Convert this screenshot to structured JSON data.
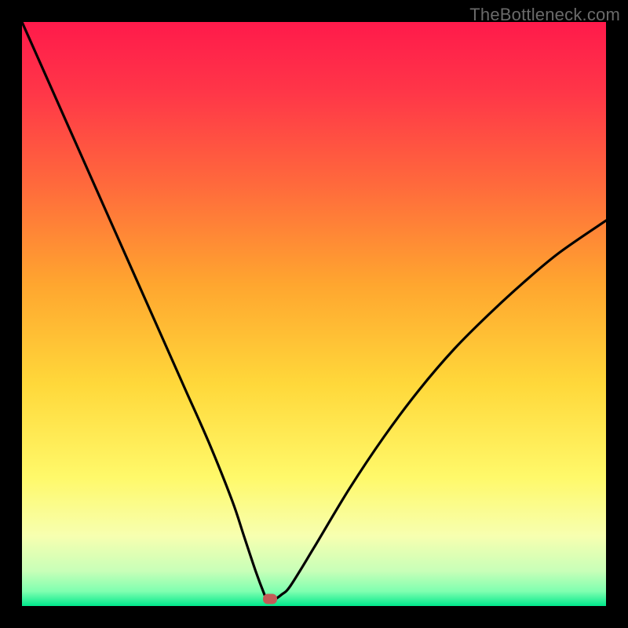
{
  "watermark": "TheBottleneck.com",
  "colors": {
    "frame": "#000000",
    "curve": "#000000",
    "marker": "#c45a57",
    "gradient_stops": [
      {
        "offset": 0.0,
        "color": "#ff1a4b"
      },
      {
        "offset": 0.12,
        "color": "#ff3648"
      },
      {
        "offset": 0.28,
        "color": "#ff6a3c"
      },
      {
        "offset": 0.45,
        "color": "#ffa62f"
      },
      {
        "offset": 0.62,
        "color": "#ffd83a"
      },
      {
        "offset": 0.78,
        "color": "#fff96a"
      },
      {
        "offset": 0.88,
        "color": "#f7ffb0"
      },
      {
        "offset": 0.94,
        "color": "#c8ffb8"
      },
      {
        "offset": 0.975,
        "color": "#7fffb0"
      },
      {
        "offset": 1.0,
        "color": "#00e88c"
      }
    ]
  },
  "chart_data": {
    "type": "line",
    "title": "",
    "xlabel": "",
    "ylabel": "",
    "xlim": [
      0,
      100
    ],
    "ylim": [
      0,
      100
    ],
    "grid": false,
    "legend": false,
    "series": [
      {
        "name": "bottleneck-curve",
        "x": [
          0,
          4,
          8,
          12,
          16,
          20,
          24,
          28,
          32,
          36,
          38,
          40,
          41.5,
          42,
          43,
          44.5,
          46,
          50,
          56,
          62,
          68,
          74,
          80,
          86,
          92,
          100
        ],
        "y": [
          100,
          91,
          82,
          73,
          64,
          55,
          46,
          37,
          28,
          18,
          12,
          6,
          2,
          1,
          1,
          2,
          3.5,
          10,
          20,
          29,
          37,
          44,
          50,
          55.5,
          60.5,
          66
        ]
      }
    ],
    "marker": {
      "x": 42.5,
      "y": 1.2
    },
    "notes": "Gradient background runs vertically from red (top = 100% bottleneck) through orange/yellow to green (bottom = 0%). Curve shows bottleneck percentage vs component balance; minimum at x≈42.5. Values estimated from pixels; no axis ticks or labels rendered."
  }
}
